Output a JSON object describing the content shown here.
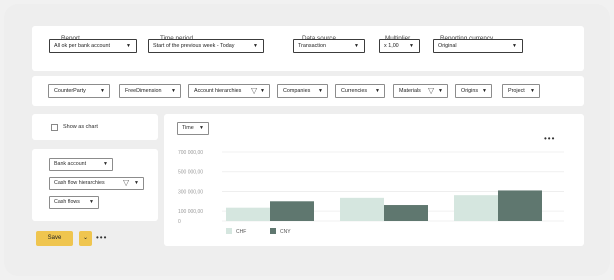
{
  "filters": {
    "report": {
      "label": "Report",
      "value": "All ok per bank account"
    },
    "time_period": {
      "label": "Time period",
      "value": "Start of the previous week - Today"
    },
    "data_source": {
      "label": "Data source",
      "value": "Transaction"
    },
    "multiplier": {
      "label": "Multiplier",
      "value": "x 1,00"
    },
    "reporting_currency": {
      "label": "Reporting currency",
      "value": "Original"
    }
  },
  "dimension_chips": [
    {
      "label": "CounterParty",
      "filtered": false
    },
    {
      "label": "FreeDimension",
      "filtered": false
    },
    {
      "label": "Account hierarchies",
      "filtered": true
    },
    {
      "label": "Companies",
      "filtered": false
    },
    {
      "label": "Currencies",
      "filtered": false
    },
    {
      "label": "Materials",
      "filtered": true
    },
    {
      "label": "Origins",
      "filtered": false
    },
    {
      "label": "Project",
      "filtered": false
    }
  ],
  "show_as_chart": {
    "label": "Show as chart",
    "checked": false
  },
  "row_dimensions": [
    {
      "label": "Bank account",
      "filtered": false
    },
    {
      "label": "Cash flow hierarchies",
      "filtered": true
    },
    {
      "label": "Cash flows",
      "filtered": false
    }
  ],
  "actions": {
    "save_label": "Save",
    "more_label": "•••"
  },
  "chart_controls": {
    "time_label": "Time",
    "more_label": "•••"
  },
  "colors": {
    "chf": "#d5e6df",
    "cny": "#5f776f",
    "save": "#efc54f"
  },
  "chart_data": {
    "type": "bar",
    "categories": [
      "",
      "",
      ""
    ],
    "series": [
      {
        "name": "CHF",
        "values": [
          135000,
          235000,
          262000
        ]
      },
      {
        "name": "CNY",
        "values": [
          200000,
          162000,
          310000
        ]
      }
    ],
    "ylim": [
      0,
      700000
    ],
    "y_ticks": [
      "0",
      "100 000,00",
      "300 000,00",
      "500 000,00",
      "700 000,00"
    ],
    "y_tick_values": [
      0,
      100000,
      300000,
      500000,
      700000
    ],
    "grid": true,
    "legend": "bottom-left"
  }
}
